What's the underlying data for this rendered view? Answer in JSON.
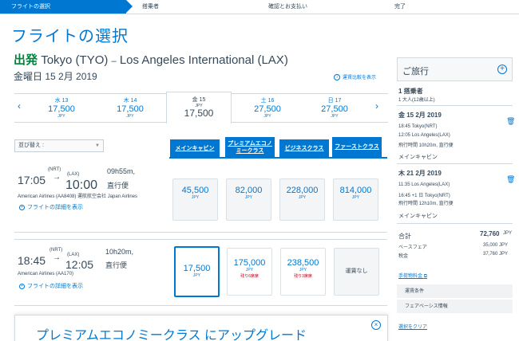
{
  "steps": [
    "フライトの選択",
    "搭乗者",
    "確認とお支払い",
    "完了"
  ],
  "page_title": "フライトの選択",
  "route": {
    "departure_label": "出発",
    "origin": "Tokyo (TYO)",
    "separator": "–",
    "destination": "Los Angeles International (LAX)"
  },
  "date_line": "金曜日 15 2月 2019",
  "fare_note": "運賃比較を表示",
  "carousel": {
    "prev": "‹",
    "next": "›",
    "days": [
      {
        "day": "水 13",
        "price": "17,500",
        "currency": "JPY"
      },
      {
        "day": "木 14",
        "price": "17,500",
        "currency": "JPY"
      },
      {
        "day": "金 15",
        "price": "17,500",
        "currency": "JPY"
      },
      {
        "day": "土 16",
        "price": "27,500",
        "currency": "JPY"
      },
      {
        "day": "日 17",
        "price": "27,500",
        "currency": "JPY"
      }
    ]
  },
  "sort_label": "並び替え :",
  "cabins": [
    "メインキャビン",
    "プレミアムエコノミークラス",
    "ビジネスクラス",
    "ファーストクラス"
  ],
  "flights": [
    {
      "depart": "17:05",
      "arrive": "10:00",
      "dep_code": "(NRT)",
      "arr_code": "(LAX)",
      "duration": "09h55m,",
      "stops": "直行便",
      "airline": "American Airlines (AA8408) 運航航空会社 Japan Airlines",
      "details": "フライトの詳細を表示",
      "fares": [
        {
          "value": "45,500",
          "currency": "JPY"
        },
        {
          "value": "82,000",
          "currency": "JPY"
        },
        {
          "value": "228,000",
          "currency": "JPY"
        },
        {
          "value": "814,000",
          "currency": "JPY"
        }
      ]
    },
    {
      "depart": "18:45",
      "arrive": "12:05",
      "dep_code": "(NRT)",
      "arr_code": "(LAX)",
      "duration": "10h20m,",
      "stops": "直行便",
      "airline": "American Airlines (AA170)",
      "details": "フライトの詳細を表示",
      "fares": [
        {
          "value": "17,500",
          "currency": "JPY"
        },
        {
          "value": "175,000",
          "currency": "JPY",
          "seats_left": "残り6席席"
        },
        {
          "value": "238,500",
          "currency": "JPY",
          "seats_left": "残り3席席"
        },
        {
          "value": "運賃なし"
        }
      ]
    }
  ],
  "upgrade_title": "プレミアムエコノミークラス にアップグレード",
  "sidebar": {
    "title": "ご旅行",
    "passengers_title": "1 搭乗者",
    "passengers_detail": "1 大人(12歳以上)",
    "seg1": {
      "date": "金 15 2月 2019",
      "dep": "18:45 Tokyo(NRT)",
      "arr": "12:05 Los Angeles(LAX)",
      "flight_time": "飛行時間 10h20m, 直行便",
      "cabin": "メインキャビン"
    },
    "seg2": {
      "date": "木 21 2月 2019",
      "dep": "11:35 Los Angeles(LAX)",
      "arr": "16:45 +1 日 Tokyo(NRT)",
      "flight_time": "飛行時間 12h10m, 直行便",
      "cabin": "メインキャビン"
    },
    "total_label": "合計",
    "total_value": "72,760",
    "total_currency": "JPY",
    "base_label": "ベースフェア",
    "base_value": "35,000 JPY",
    "tax_label": "税金",
    "tax_value": "37,760 JPY",
    "baggage_link": "手荷物料金",
    "fare_rules": "運賃条件",
    "fare_basis": "フェアベーシス情報",
    "clear": "選択をクリア"
  },
  "colors": {
    "accent": "#0078d2",
    "text": "#36495a",
    "departure": "#00843d",
    "alert": "#c30019"
  }
}
